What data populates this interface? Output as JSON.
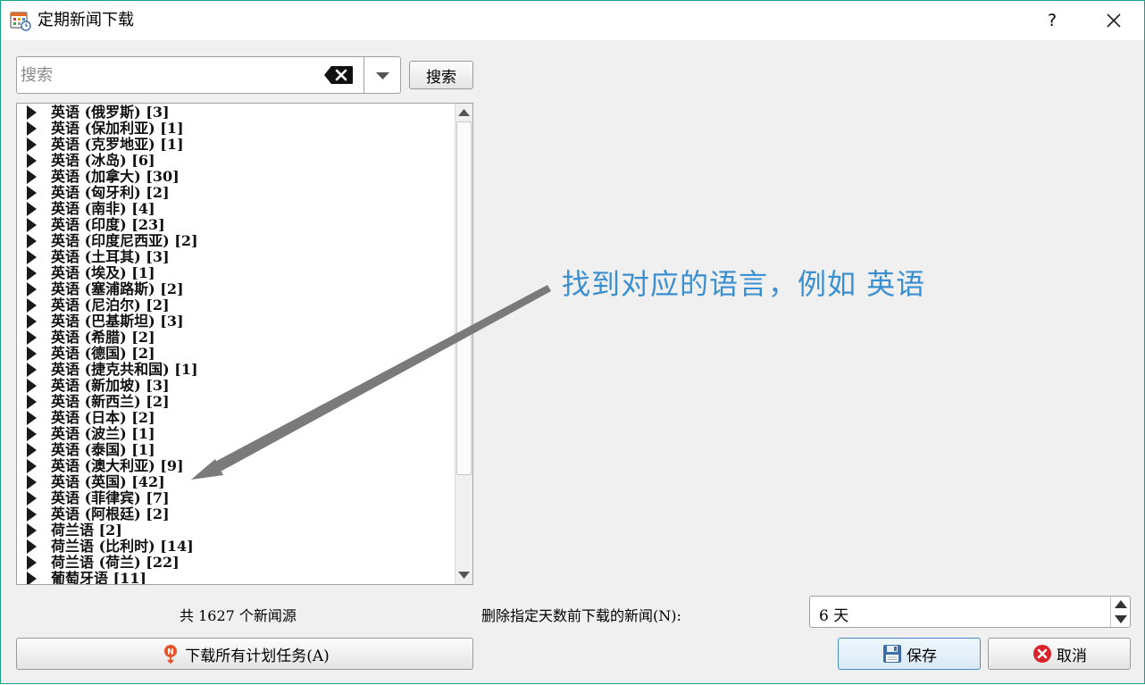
{
  "window": {
    "title": "定期新闻下载",
    "help": "?"
  },
  "search": {
    "placeholder": "搜索",
    "button_label": "搜索"
  },
  "list": {
    "items": [
      "英语 (俄罗斯) [3]",
      "英语 (保加利亚) [1]",
      "英语 (克罗地亚) [1]",
      "英语 (冰岛) [6]",
      "英语 (加拿大) [30]",
      "英语 (匈牙利) [2]",
      "英语 (南非) [4]",
      "英语 (印度) [23]",
      "英语 (印度尼西亚) [2]",
      "英语 (土耳其) [3]",
      "英语 (埃及) [1]",
      "英语 (塞浦路斯) [2]",
      "英语 (尼泊尔) [2]",
      "英语 (巴基斯坦) [3]",
      "英语 (希腊) [2]",
      "英语 (德国) [2]",
      "英语 (捷克共和国) [1]",
      "英语 (新加坡) [3]",
      "英语 (新西兰) [2]",
      "英语 (日本) [2]",
      "英语 (波兰) [1]",
      "英语 (泰国) [1]",
      "英语 (澳大利亚) [9]",
      "英语 (英国) [42]",
      "英语 (菲律宾) [7]",
      "英语 (阿根廷) [2]",
      "荷兰语 [2]",
      "荷兰语 (比利时) [14]",
      "荷兰语 (荷兰) [22]",
      "葡萄牙语 [11]"
    ]
  },
  "annotation": "找到对应的语言，例如 英语",
  "footer": {
    "count": "共 1627 个新闻源",
    "delete_label": "删除指定天数前下载的新闻(N):",
    "days_value": "6 天",
    "download_all": "下载所有计划任务(A)",
    "save": "保存",
    "cancel": "取消"
  },
  "colors": {
    "annotation": "#3a8fd0",
    "accent_border": "#16a085",
    "save_border": "#4a8ac8"
  }
}
